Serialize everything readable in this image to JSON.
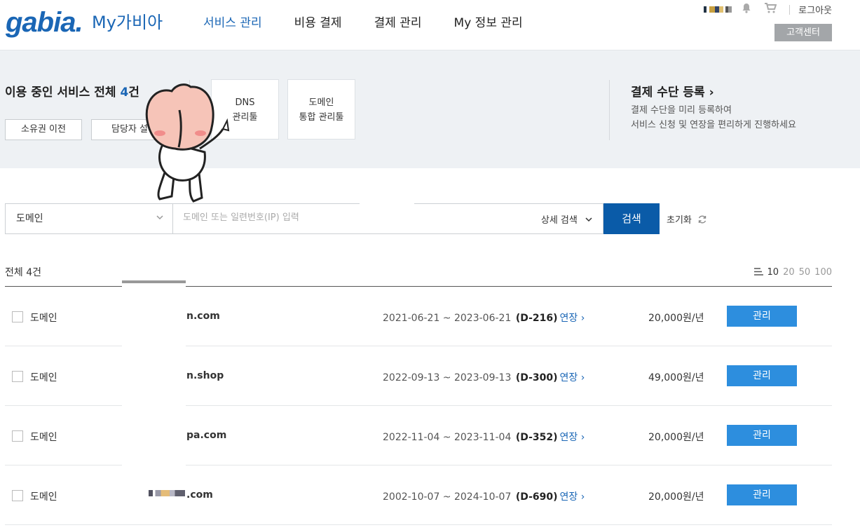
{
  "header": {
    "logo": "gabia.",
    "site_title": "My가비아",
    "nav": [
      {
        "label": "서비스 관리",
        "active": true
      },
      {
        "label": "비용 결제",
        "active": false
      },
      {
        "label": "결제 관리",
        "active": false
      },
      {
        "label": "My 정보 관리",
        "active": false
      }
    ],
    "logout": "로그아웃",
    "customer_center": "고객센터"
  },
  "summary": {
    "title_prefix": "이용 중인 서비스 전체 ",
    "count": "4",
    "title_suffix": "건",
    "buttons": [
      "소유권 이전",
      "담당자 설"
    ],
    "tools": [
      {
        "line1": "DNS",
        "line2": "관리툴"
      },
      {
        "line1": "도메인",
        "line2": "통합 관리툴"
      }
    ],
    "payment": {
      "title": "결제 수단 등록 ",
      "desc1": "결제 수단을 미리 등록하여",
      "desc2": "서비스 신청 및 연장을 편리하게 진행하세요"
    }
  },
  "search": {
    "select_value": "도메인",
    "placeholder": "도메인 또는 일련번호(IP) 입력",
    "detail": "상세 검색",
    "button": "검색",
    "reset": "초기화"
  },
  "list": {
    "total": "전체 4건",
    "page_sizes": [
      "10",
      "20",
      "50",
      "100"
    ],
    "renew_label": "연장",
    "manage_label": "관리",
    "rows": [
      {
        "type": "도메인",
        "domain_suffix": "n.com",
        "period": "2021-06-21 ~ 2023-06-21",
        "dday": "(D-216)",
        "price": "20,000원/년"
      },
      {
        "type": "도메인",
        "domain_suffix": "n.shop",
        "period": "2022-09-13 ~ 2023-09-13",
        "dday": "(D-300)",
        "price": "49,000원/년"
      },
      {
        "type": "도메인",
        "domain_suffix": "pa.com",
        "period": "2022-11-04 ~ 2023-11-04",
        "dday": "(D-352)",
        "price": "20,000원/년"
      },
      {
        "type": "도메인",
        "domain_suffix": ".com",
        "period": "2002-10-07 ~ 2024-10-07",
        "dday": "(D-690)",
        "price": "20,000원/년"
      }
    ]
  },
  "colors": {
    "brand": "#1a66b5",
    "search_button": "#0a5ba8",
    "manage_button": "#2d8ede"
  }
}
